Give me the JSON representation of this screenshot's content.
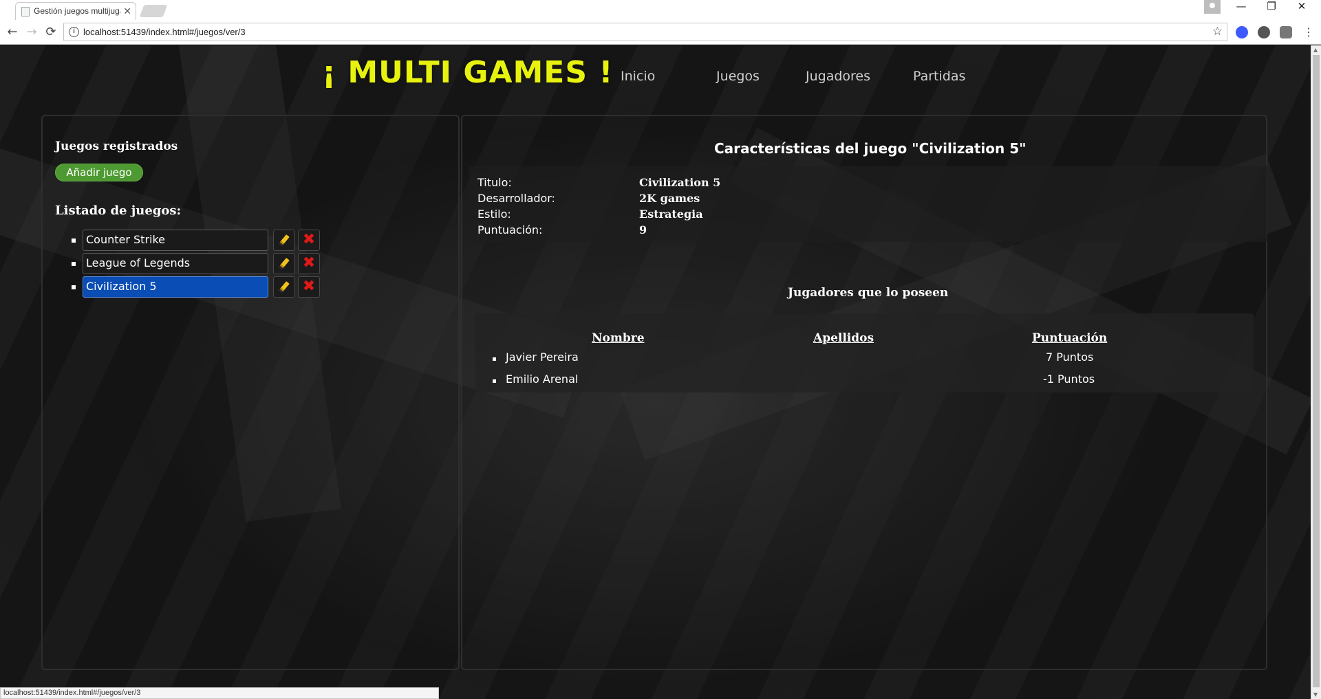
{
  "browser": {
    "tab_title": "Gestión juegos multijugador",
    "url": "localhost:51439/index.html#/juegos/ver/3",
    "status_url": "localhost:51439/index.html#/juegos/ver/3",
    "win_minimize": "—",
    "win_restore": "❐",
    "win_close": "✕",
    "back": "←",
    "forward": "→",
    "reload": "⟳",
    "star": "☆",
    "tab_close": "✕",
    "info": "i"
  },
  "site": {
    "logo": "¡ MULTI GAMES !",
    "logo_color": "#e7f20f",
    "nav": [
      "Inicio",
      "Juegos",
      "Jugadores",
      "Partidas"
    ]
  },
  "sidebar": {
    "heading": "Juegos registrados",
    "add_button": "Añadir juego",
    "list_heading": "Listado de juegos:",
    "games": [
      {
        "name": "Counter Strike",
        "selected": false
      },
      {
        "name": "League of Legends",
        "selected": false
      },
      {
        "name": "Civilization 5",
        "selected": true
      }
    ]
  },
  "details": {
    "heading": "Características del juego \"Civilization 5\"",
    "fields": [
      {
        "label": "Titulo:",
        "value": "Civilization 5"
      },
      {
        "label": "Desarrollador:",
        "value": "2K games"
      },
      {
        "label": "Estilo:",
        "value": "Estrategia"
      },
      {
        "label": "Puntuación:",
        "value": "9"
      }
    ]
  },
  "players": {
    "heading": "Jugadores que lo poseen",
    "columns": [
      "Nombre",
      "Apellidos",
      "Puntuación"
    ],
    "rows": [
      {
        "name": "Javier Pereira",
        "score": "7 Puntos"
      },
      {
        "name": "Emilio Arenal",
        "score": "-1 Puntos"
      }
    ]
  }
}
